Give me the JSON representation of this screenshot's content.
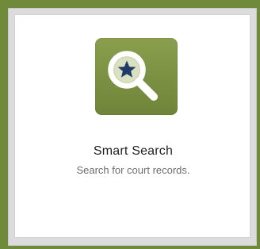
{
  "card": {
    "title": "Smart Search",
    "subtitle": "Search for court records.",
    "icon": "magnifier-star-icon"
  },
  "colors": {
    "frame_accent": "#6f8a3a",
    "icon_tile": "#7f9444",
    "star": "#1f3b67",
    "title_text": "#1f1f1f",
    "subtitle_text": "#6e6e6e"
  }
}
